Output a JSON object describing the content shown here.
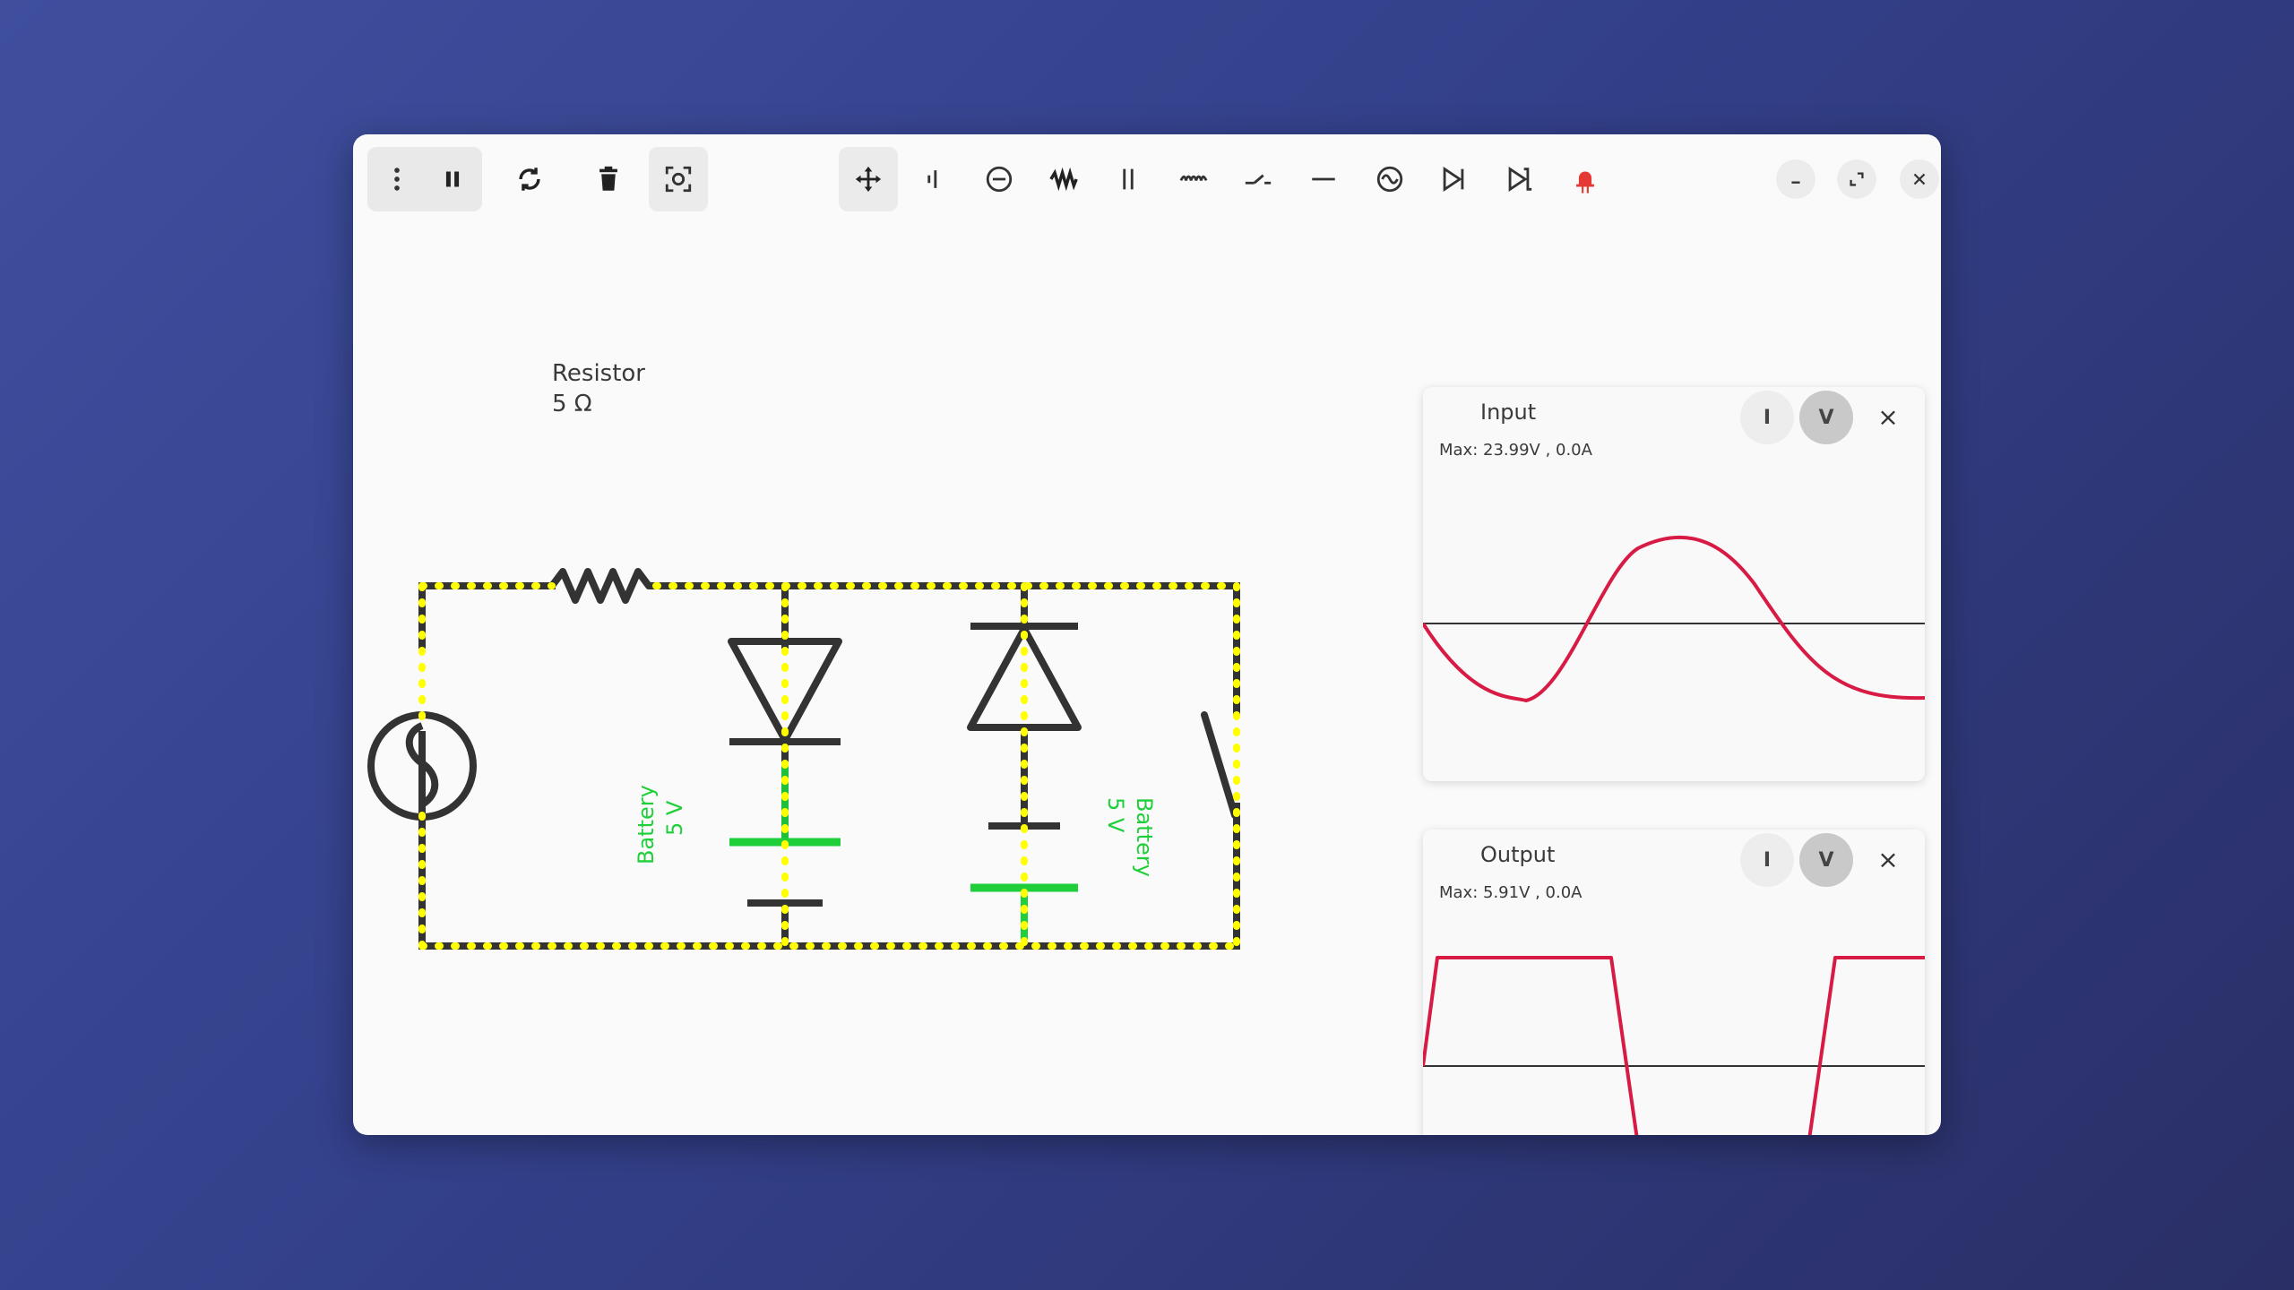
{
  "toolbar": {
    "icons": [
      "menu-icon",
      "pause-icon",
      "refresh-icon",
      "delete-icon",
      "screenshot-icon",
      "move-icon",
      "probe-icon",
      "ammeter-icon",
      "resistor-icon",
      "capacitor-icon",
      "inductor-icon",
      "switch-icon",
      "wire-icon",
      "ac-source-icon",
      "diode-icon",
      "zener-icon",
      "led-icon"
    ],
    "window_controls": [
      "minimize",
      "maximize",
      "close"
    ]
  },
  "circuit": {
    "resistor_name": "Resistor",
    "resistor_value": "5 Ω",
    "battery1_name": "Battery",
    "battery1_value": "5 V",
    "battery2_name": "Battery",
    "battery2_value": "5 V"
  },
  "scopes": [
    {
      "title": "Input",
      "max": "Max: 23.99V , 0.0A",
      "mode_i": "I",
      "mode_v": "V",
      "close": "×"
    },
    {
      "title": "Output",
      "max": "Max: 5.91V , 0.0A",
      "mode_i": "I",
      "mode_v": "V",
      "close": "×"
    }
  ],
  "colors": {
    "wire": "#333333",
    "current": "#ffff00",
    "battery": "#1fcf3a",
    "trace": "#d81b45",
    "led": "#e53935"
  }
}
